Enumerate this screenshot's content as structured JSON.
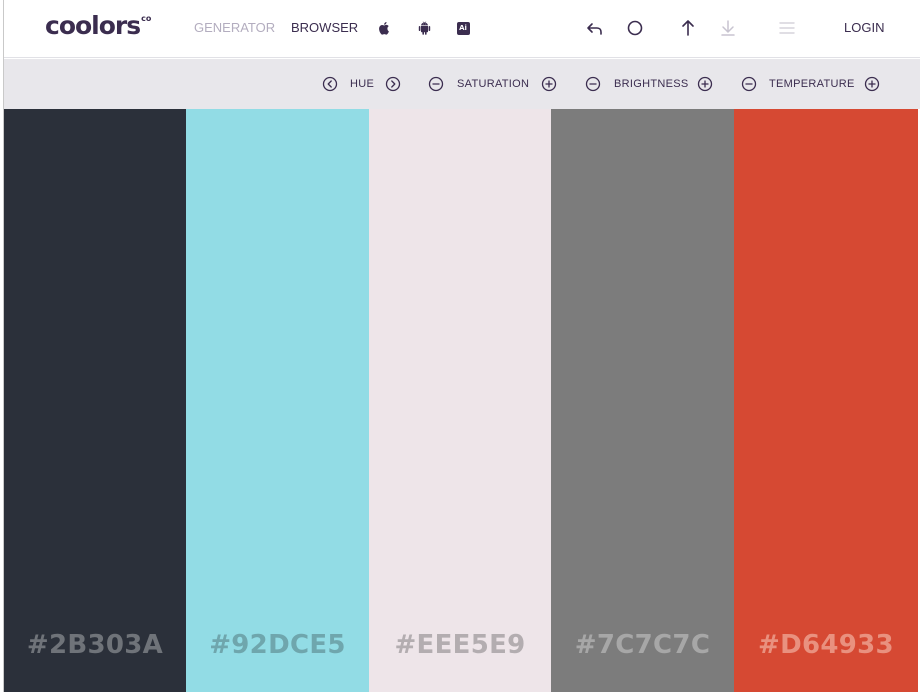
{
  "header": {
    "logo_text": "coolors",
    "logo_mark": "co",
    "nav": {
      "generator": "GENERATOR",
      "browser": "BROWSER",
      "login": "LOGIN"
    },
    "icons": [
      "apple-icon",
      "android-icon",
      "adobe-illustrator-icon",
      "undo-icon",
      "circle-icon",
      "up-arrow-icon",
      "download-icon",
      "menu-icon"
    ],
    "ai_badge": "Ai"
  },
  "adjustments": {
    "hue": "HUE",
    "saturation": "SATURATION",
    "brightness": "BRIGHTNESS",
    "temperature": "TEMPERATURE"
  },
  "palette": [
    {
      "hex": "#2B303A",
      "bg": "#2b303a",
      "label_color": "#6f7379"
    },
    {
      "hex": "#92DCE5",
      "bg": "#92dce5",
      "label_color": "#6fa6ad"
    },
    {
      "hex": "#EEE5E9",
      "bg": "#eee5e9",
      "label_color": "#b3adb0"
    },
    {
      "hex": "#7C7C7C",
      "bg": "#7c7c7c",
      "label_color": "#a7a7a7"
    },
    {
      "hex": "#D64933",
      "bg": "#d64933",
      "label_color": "#e9917f"
    }
  ],
  "colors": {
    "brand": "#3b2d4f",
    "nav_dim": "#b3adbf",
    "toolbar_bg": "#e8e7eb"
  }
}
